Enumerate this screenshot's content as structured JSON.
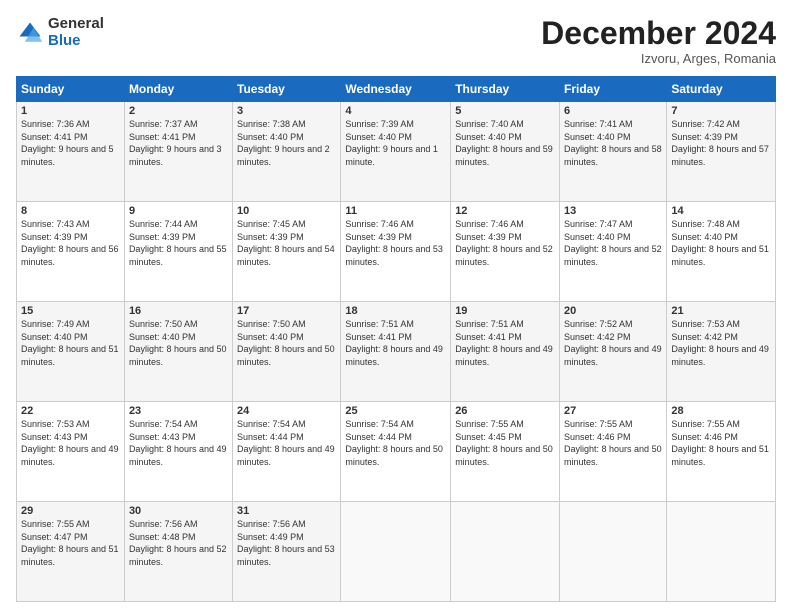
{
  "logo": {
    "general": "General",
    "blue": "Blue"
  },
  "header": {
    "month": "December 2024",
    "location": "Izvoru, Arges, Romania"
  },
  "days_of_week": [
    "Sunday",
    "Monday",
    "Tuesday",
    "Wednesday",
    "Thursday",
    "Friday",
    "Saturday"
  ],
  "weeks": [
    [
      {
        "day": "1",
        "sunrise": "7:36 AM",
        "sunset": "4:41 PM",
        "daylight": "9 hours and 5 minutes."
      },
      {
        "day": "2",
        "sunrise": "7:37 AM",
        "sunset": "4:41 PM",
        "daylight": "9 hours and 3 minutes."
      },
      {
        "day": "3",
        "sunrise": "7:38 AM",
        "sunset": "4:40 PM",
        "daylight": "9 hours and 2 minutes."
      },
      {
        "day": "4",
        "sunrise": "7:39 AM",
        "sunset": "4:40 PM",
        "daylight": "9 hours and 1 minute."
      },
      {
        "day": "5",
        "sunrise": "7:40 AM",
        "sunset": "4:40 PM",
        "daylight": "8 hours and 59 minutes."
      },
      {
        "day": "6",
        "sunrise": "7:41 AM",
        "sunset": "4:40 PM",
        "daylight": "8 hours and 58 minutes."
      },
      {
        "day": "7",
        "sunrise": "7:42 AM",
        "sunset": "4:39 PM",
        "daylight": "8 hours and 57 minutes."
      }
    ],
    [
      {
        "day": "8",
        "sunrise": "7:43 AM",
        "sunset": "4:39 PM",
        "daylight": "8 hours and 56 minutes."
      },
      {
        "day": "9",
        "sunrise": "7:44 AM",
        "sunset": "4:39 PM",
        "daylight": "8 hours and 55 minutes."
      },
      {
        "day": "10",
        "sunrise": "7:45 AM",
        "sunset": "4:39 PM",
        "daylight": "8 hours and 54 minutes."
      },
      {
        "day": "11",
        "sunrise": "7:46 AM",
        "sunset": "4:39 PM",
        "daylight": "8 hours and 53 minutes."
      },
      {
        "day": "12",
        "sunrise": "7:46 AM",
        "sunset": "4:39 PM",
        "daylight": "8 hours and 52 minutes."
      },
      {
        "day": "13",
        "sunrise": "7:47 AM",
        "sunset": "4:40 PM",
        "daylight": "8 hours and 52 minutes."
      },
      {
        "day": "14",
        "sunrise": "7:48 AM",
        "sunset": "4:40 PM",
        "daylight": "8 hours and 51 minutes."
      }
    ],
    [
      {
        "day": "15",
        "sunrise": "7:49 AM",
        "sunset": "4:40 PM",
        "daylight": "8 hours and 51 minutes."
      },
      {
        "day": "16",
        "sunrise": "7:50 AM",
        "sunset": "4:40 PM",
        "daylight": "8 hours and 50 minutes."
      },
      {
        "day": "17",
        "sunrise": "7:50 AM",
        "sunset": "4:40 PM",
        "daylight": "8 hours and 50 minutes."
      },
      {
        "day": "18",
        "sunrise": "7:51 AM",
        "sunset": "4:41 PM",
        "daylight": "8 hours and 49 minutes."
      },
      {
        "day": "19",
        "sunrise": "7:51 AM",
        "sunset": "4:41 PM",
        "daylight": "8 hours and 49 minutes."
      },
      {
        "day": "20",
        "sunrise": "7:52 AM",
        "sunset": "4:42 PM",
        "daylight": "8 hours and 49 minutes."
      },
      {
        "day": "21",
        "sunrise": "7:53 AM",
        "sunset": "4:42 PM",
        "daylight": "8 hours and 49 minutes."
      }
    ],
    [
      {
        "day": "22",
        "sunrise": "7:53 AM",
        "sunset": "4:43 PM",
        "daylight": "8 hours and 49 minutes."
      },
      {
        "day": "23",
        "sunrise": "7:54 AM",
        "sunset": "4:43 PM",
        "daylight": "8 hours and 49 minutes."
      },
      {
        "day": "24",
        "sunrise": "7:54 AM",
        "sunset": "4:44 PM",
        "daylight": "8 hours and 49 minutes."
      },
      {
        "day": "25",
        "sunrise": "7:54 AM",
        "sunset": "4:44 PM",
        "daylight": "8 hours and 50 minutes."
      },
      {
        "day": "26",
        "sunrise": "7:55 AM",
        "sunset": "4:45 PM",
        "daylight": "8 hours and 50 minutes."
      },
      {
        "day": "27",
        "sunrise": "7:55 AM",
        "sunset": "4:46 PM",
        "daylight": "8 hours and 50 minutes."
      },
      {
        "day": "28",
        "sunrise": "7:55 AM",
        "sunset": "4:46 PM",
        "daylight": "8 hours and 51 minutes."
      }
    ],
    [
      {
        "day": "29",
        "sunrise": "7:55 AM",
        "sunset": "4:47 PM",
        "daylight": "8 hours and 51 minutes."
      },
      {
        "day": "30",
        "sunrise": "7:56 AM",
        "sunset": "4:48 PM",
        "daylight": "8 hours and 52 minutes."
      },
      {
        "day": "31",
        "sunrise": "7:56 AM",
        "sunset": "4:49 PM",
        "daylight": "8 hours and 53 minutes."
      },
      null,
      null,
      null,
      null
    ]
  ]
}
